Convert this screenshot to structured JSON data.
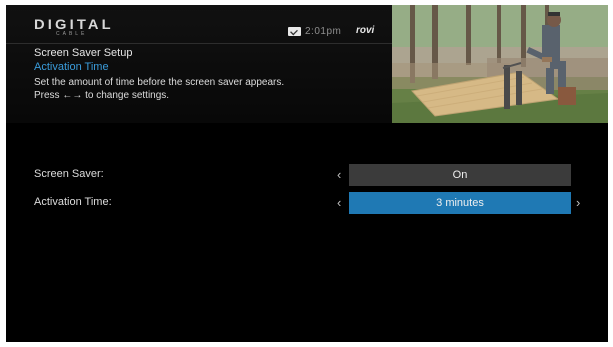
{
  "brand": {
    "logo_main": "DIGITAL",
    "logo_sub": "CABLE",
    "partner": "rovi"
  },
  "status": {
    "time": "2:01pm",
    "mail_icon": "mail-icon"
  },
  "info": {
    "title": "Screen Saver Setup",
    "subtitle": "Activation Time",
    "description_line_1": "Set the amount of time before the screen saver appears.",
    "description_line_2": "Press ←→ to change settings."
  },
  "settings": [
    {
      "label": "Screen Saver:",
      "value": "On",
      "selected": false
    },
    {
      "label": "Activation Time:",
      "value": "3 minutes",
      "selected": true
    }
  ],
  "colors": {
    "accent": "#1f79b4",
    "subtitle": "#3a9cdb",
    "unselected_value_bg": "#3b3b3b",
    "screen_bg": "#050505"
  }
}
